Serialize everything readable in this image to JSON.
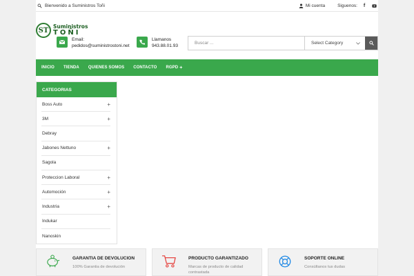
{
  "topbar": {
    "welcome": "Bienvenido a Suministros Toñi",
    "account": "Mi cuenta",
    "follow": "Siguenos:",
    "social": [
      "facebook-icon",
      "youtube-icon"
    ]
  },
  "logo": {
    "mark": "ST",
    "line1": "Suministros",
    "line2": "TOÑI"
  },
  "contact_email": {
    "label": "Email:",
    "value": "pedidos@suministrostoni.net"
  },
  "contact_phone": {
    "label": "Llamanos",
    "value": "943.88.01.93"
  },
  "search": {
    "placeholder": "Buscar ...",
    "category": "Select Category"
  },
  "nav": {
    "items": [
      "INICIO",
      "TIENDA",
      "QUIENES SOMOS",
      "CONTACTO",
      "RGPD"
    ]
  },
  "categories": {
    "title": "CATEGORIAS",
    "items": [
      {
        "label": "Boss Auto",
        "expand": "+"
      },
      {
        "label": "3M",
        "expand": "+"
      },
      {
        "label": "Debray",
        "expand": ""
      },
      {
        "label": "Jabones Nettuno",
        "expand": "+"
      },
      {
        "label": "Sagola",
        "expand": ""
      },
      {
        "label": "Proteccion Laboral",
        "expand": "+"
      },
      {
        "label": "Automoción",
        "expand": "+"
      },
      {
        "label": "Industria",
        "expand": "+"
      },
      {
        "label": "Indukar",
        "expand": ""
      },
      {
        "label": "Nanoskin",
        "expand": ""
      }
    ]
  },
  "features": [
    {
      "title": "GARANTIA DE DEVOLUCION",
      "desc": "100% Garantia de devolución",
      "icon": "piggy-bank-icon"
    },
    {
      "title": "PRODUCTO GARANTIZADO",
      "desc": "Marcas de producto de calidad contrastada",
      "icon": "cart-icon"
    },
    {
      "title": "SOPORTE ONLINE",
      "desc": "Consúltanos tus dudas",
      "icon": "lifebuoy-icon"
    }
  ],
  "colors": {
    "accent": "#3aa84c",
    "search_button": "#5a5a5a",
    "feature_icon": "#e53935",
    "lifebuoy": "#1e88e5"
  }
}
